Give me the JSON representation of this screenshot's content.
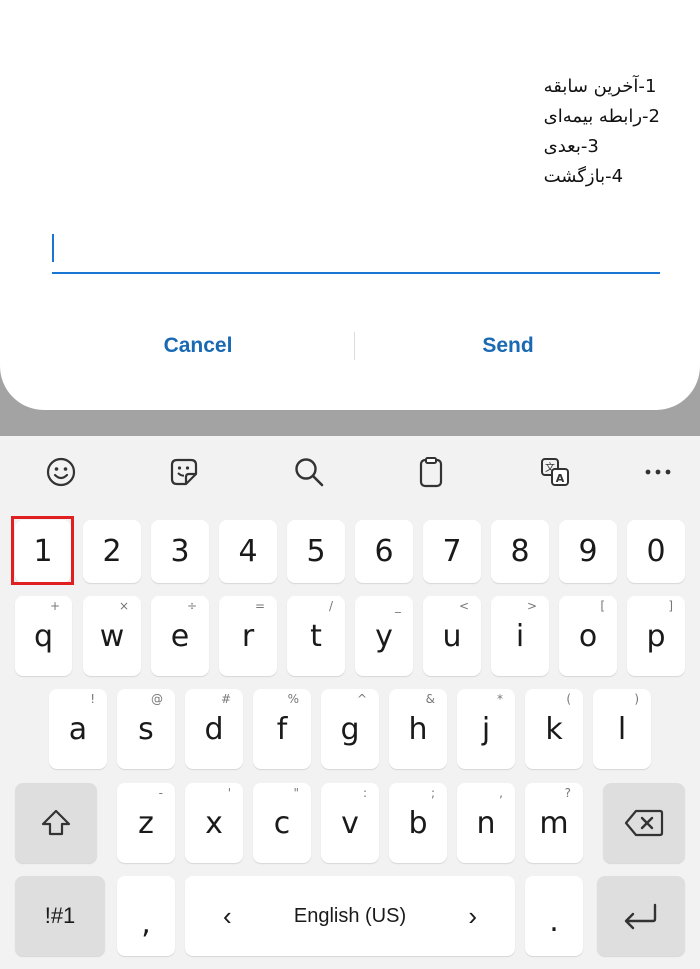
{
  "dialog": {
    "menu": [
      "1-آخرین سابقه",
      "2-رابطه بیمه‌ای",
      "3-بعدی",
      "4-بازگشت"
    ],
    "input_value": "",
    "cancel_label": "Cancel",
    "send_label": "Send",
    "accent_color": "#1976d2"
  },
  "keyboard": {
    "toolbar": [
      "emoji-icon",
      "sticker-icon",
      "search-icon",
      "clipboard-icon",
      "translate-icon",
      "more-icon"
    ],
    "number_row": [
      "1",
      "2",
      "3",
      "4",
      "5",
      "6",
      "7",
      "8",
      "9",
      "0"
    ],
    "row1": [
      {
        "key": "q",
        "alt": "+"
      },
      {
        "key": "w",
        "alt": "×"
      },
      {
        "key": "e",
        "alt": "÷"
      },
      {
        "key": "r",
        "alt": "="
      },
      {
        "key": "t",
        "alt": "/"
      },
      {
        "key": "y",
        "alt": "_"
      },
      {
        "key": "u",
        "alt": "<"
      },
      {
        "key": "i",
        "alt": ">"
      },
      {
        "key": "o",
        "alt": "["
      },
      {
        "key": "p",
        "alt": "]"
      }
    ],
    "row2": [
      {
        "key": "a",
        "alt": "!"
      },
      {
        "key": "s",
        "alt": "@"
      },
      {
        "key": "d",
        "alt": "#"
      },
      {
        "key": "f",
        "alt": "%"
      },
      {
        "key": "g",
        "alt": "^"
      },
      {
        "key": "h",
        "alt": "&"
      },
      {
        "key": "j",
        "alt": "*"
      },
      {
        "key": "k",
        "alt": "("
      },
      {
        "key": "l",
        "alt": ")"
      }
    ],
    "row3": [
      {
        "key": "z",
        "alt": "-"
      },
      {
        "key": "x",
        "alt": "'"
      },
      {
        "key": "c",
        "alt": "\""
      },
      {
        "key": "v",
        "alt": ":"
      },
      {
        "key": "b",
        "alt": ";"
      },
      {
        "key": "n",
        "alt": ","
      },
      {
        "key": "m",
        "alt": "?"
      }
    ],
    "symbols_label": "!#1",
    "comma_label": ",",
    "period_label": ".",
    "space_label": "English (US)",
    "space_left_arrow": "‹",
    "space_right_arrow": "›",
    "highlighted_key": "1",
    "highlight_color": "#e02020"
  }
}
